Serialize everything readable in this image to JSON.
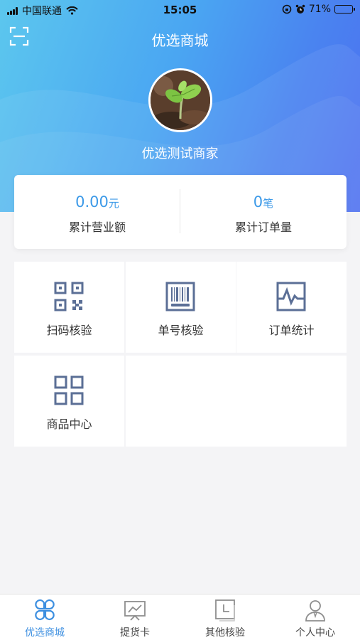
{
  "status_bar": {
    "carrier": "中国联通",
    "time": "15:05",
    "battery": "71%",
    "battery_level": 0.71,
    "icons": [
      "signal-icon",
      "wifi-icon",
      "orientation-lock-icon",
      "alarm-icon",
      "battery-icon"
    ]
  },
  "header": {
    "title": "优选商城",
    "scan_icon": "scan-icon"
  },
  "merchant": {
    "name": "优选测试商家",
    "avatar": "plant-sprout-photo"
  },
  "stats": {
    "revenue": {
      "value": "0.00",
      "unit": "元",
      "label": "累计营业额"
    },
    "orders": {
      "value": "0",
      "unit": "笔",
      "label": "累计订单量"
    }
  },
  "menu": [
    {
      "label": "扫码核验",
      "icon": "qr-code-icon"
    },
    {
      "label": "单号核验",
      "icon": "barcode-icon"
    },
    {
      "label": "订单统计",
      "icon": "chart-icon"
    },
    {
      "label": "商品中心",
      "icon": "grid-icon"
    }
  ],
  "tabs": [
    {
      "label": "优选商城",
      "icon": "store-clover-icon",
      "active": true
    },
    {
      "label": "提货卡",
      "icon": "pickup-card-icon",
      "active": false
    },
    {
      "label": "其他核验",
      "icon": "verify-icon",
      "active": false
    },
    {
      "label": "个人中心",
      "icon": "user-icon",
      "active": false
    }
  ],
  "colors": {
    "accent": "#3d9ae8",
    "icon": "#5b6f96",
    "hero_start": "#5cc7ee",
    "hero_end": "#4c6ef0"
  }
}
